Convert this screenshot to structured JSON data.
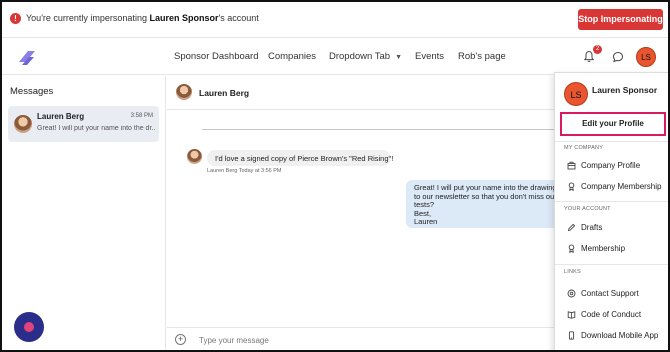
{
  "impersonation": {
    "prefix": "You're currently impersonating",
    "name": "Lauren Sponsor",
    "suffix": "'s account",
    "stop_label": "Stop Impersonating"
  },
  "nav": {
    "items": [
      "Sponsor Dashboard",
      "Companies",
      "Dropdown Tab",
      "Events",
      "Rob's page"
    ],
    "notification_count": "2",
    "avatar_initials": "LS"
  },
  "sidebar": {
    "title": "Messages",
    "conversations": [
      {
        "name": "Lauren Berg",
        "time": "3:58 PM",
        "preview": "Great! I will put your name into the dr..."
      }
    ]
  },
  "conversation": {
    "header_name": "Lauren Berg",
    "incoming": {
      "text": "I'd love a signed copy of Pierce Brown's \"Red Rising\"!",
      "meta": "Lauren Berg  Today at 3:56 PM"
    },
    "outgoing_lines": [
      "Great! I will put your name into the drawing.",
      "to our newsletter so that you don't miss out",
      "tests?",
      "Best,",
      "Lauren"
    ],
    "composer_placeholder": "Type your message"
  },
  "menu": {
    "avatar_initials": "LS",
    "name": "Lauren Sponsor",
    "edit_profile": "Edit your Profile",
    "sections": {
      "company": "MY COMPANY",
      "account": "YOUR ACCOUNT",
      "links": "LINKS"
    },
    "company_items": [
      "Company Profile",
      "Company Membership"
    ],
    "account_items": [
      "Drafts",
      "Membership"
    ],
    "link_items": [
      "Contact Support",
      "Code of Conduct",
      "Download Mobile App"
    ]
  },
  "colors": {
    "danger": "#d93636",
    "avatar": "#e8552e",
    "highlight": "#d81b60",
    "fab": "#2a2d8a",
    "outgoing_bubble": "#dce9f7"
  }
}
